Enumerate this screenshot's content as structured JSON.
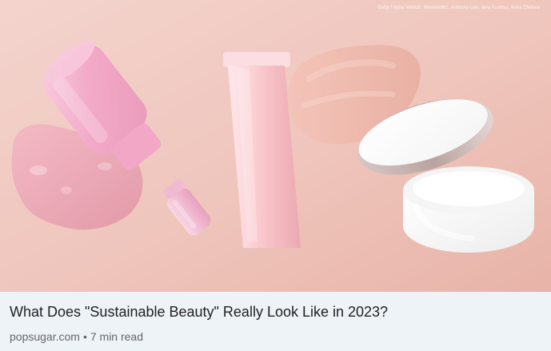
{
  "article": {
    "title": "What Does \"Sustainable Beauty\" Really Look Like in 2023?",
    "source": "popsugar.com",
    "separator": "•",
    "read_time": "7 min read"
  },
  "image": {
    "credit": "Getty / Iryna Veklich, Westend61, Anthony Lee, Iana Kunitsa, Anna Efetova"
  },
  "colors": {
    "meta_background": "#eef3f8",
    "title_text": "#1f1f1f",
    "subline_text": "#666666",
    "hero_background": "#f2c9c0"
  },
  "icons": [
    "serum-bottle-image",
    "dropper-cap-image",
    "gel-splash-image",
    "cream-tube-image",
    "foundation-swatch-image",
    "cream-jar-image"
  ]
}
